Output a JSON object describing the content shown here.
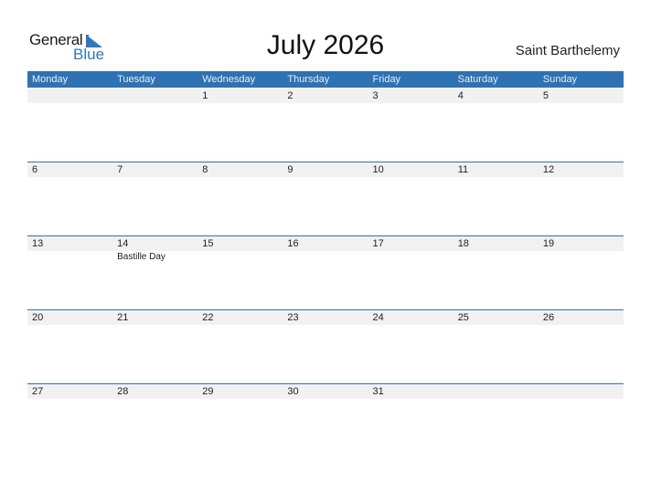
{
  "logo": {
    "word1": "General",
    "word2": "Blue"
  },
  "title": "July 2026",
  "country": "Saint Barthelemy",
  "colors": {
    "header_bg": "#2e72b4",
    "strip_bg": "#f1f1f1",
    "logo_blue": "#2e78c1"
  },
  "weekdays": [
    "Monday",
    "Tuesday",
    "Wednesday",
    "Thursday",
    "Friday",
    "Saturday",
    "Sunday"
  ],
  "weeks": [
    {
      "days": [
        {
          "num": "",
          "event": ""
        },
        {
          "num": "",
          "event": ""
        },
        {
          "num": "1",
          "event": ""
        },
        {
          "num": "2",
          "event": ""
        },
        {
          "num": "3",
          "event": ""
        },
        {
          "num": "4",
          "event": ""
        },
        {
          "num": "5",
          "event": ""
        }
      ]
    },
    {
      "days": [
        {
          "num": "6",
          "event": ""
        },
        {
          "num": "7",
          "event": ""
        },
        {
          "num": "8",
          "event": ""
        },
        {
          "num": "9",
          "event": ""
        },
        {
          "num": "10",
          "event": ""
        },
        {
          "num": "11",
          "event": ""
        },
        {
          "num": "12",
          "event": ""
        }
      ]
    },
    {
      "days": [
        {
          "num": "13",
          "event": ""
        },
        {
          "num": "14",
          "event": "Bastille Day"
        },
        {
          "num": "15",
          "event": ""
        },
        {
          "num": "16",
          "event": ""
        },
        {
          "num": "17",
          "event": ""
        },
        {
          "num": "18",
          "event": ""
        },
        {
          "num": "19",
          "event": ""
        }
      ]
    },
    {
      "days": [
        {
          "num": "20",
          "event": ""
        },
        {
          "num": "21",
          "event": ""
        },
        {
          "num": "22",
          "event": ""
        },
        {
          "num": "23",
          "event": ""
        },
        {
          "num": "24",
          "event": ""
        },
        {
          "num": "25",
          "event": ""
        },
        {
          "num": "26",
          "event": ""
        }
      ]
    },
    {
      "days": [
        {
          "num": "27",
          "event": ""
        },
        {
          "num": "28",
          "event": ""
        },
        {
          "num": "29",
          "event": ""
        },
        {
          "num": "30",
          "event": ""
        },
        {
          "num": "31",
          "event": ""
        },
        {
          "num": "",
          "event": ""
        },
        {
          "num": "",
          "event": ""
        }
      ]
    }
  ]
}
